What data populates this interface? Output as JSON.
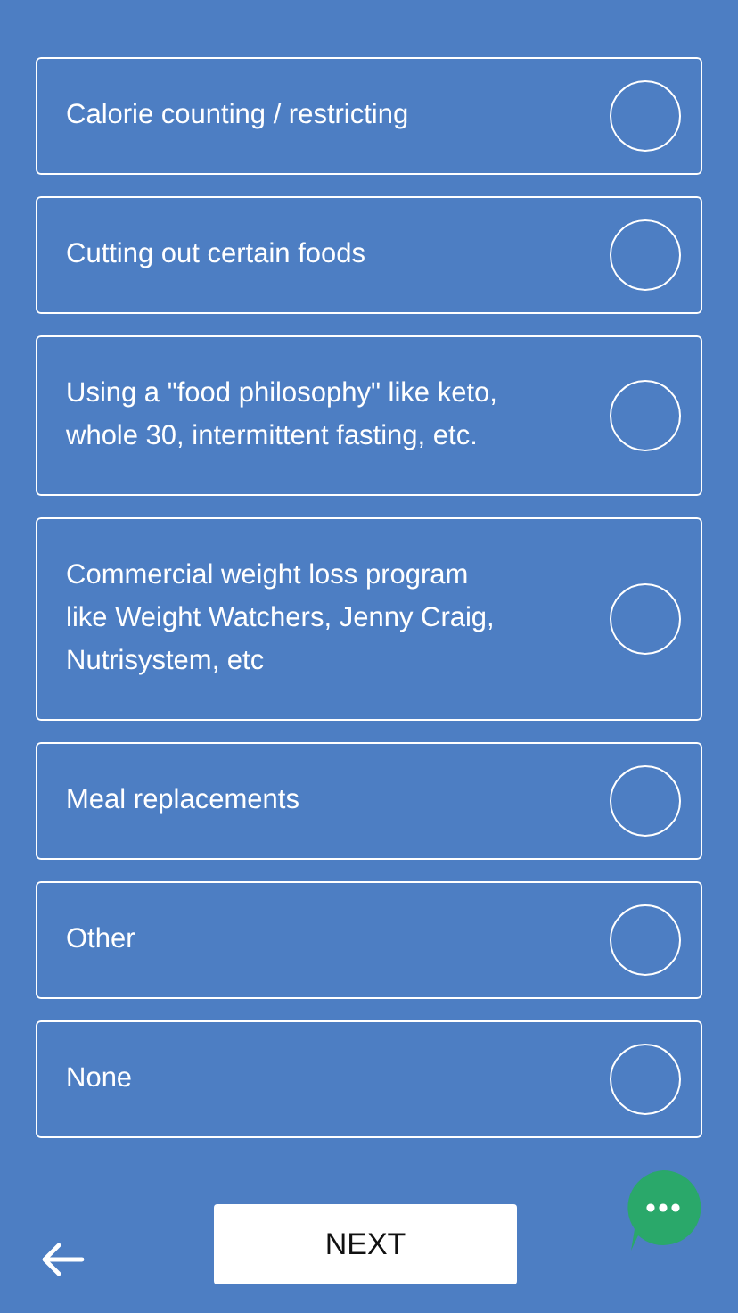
{
  "options": [
    {
      "label_lines": [
        "Calorie counting / restricting"
      ],
      "selected": false
    },
    {
      "label_lines": [
        "Cutting out certain foods"
      ],
      "selected": false
    },
    {
      "label_lines": [
        "Using a \"food philosophy\" like keto,",
        "whole 30, intermittent fasting, etc."
      ],
      "selected": false
    },
    {
      "label_lines": [
        "Commercial weight loss program",
        "like Weight Watchers, Jenny Craig,",
        "Nutrisystem, etc"
      ],
      "selected": false
    },
    {
      "label_lines": [
        "Meal replacements"
      ],
      "selected": false
    },
    {
      "label_lines": [
        "Other"
      ],
      "selected": false
    },
    {
      "label_lines": [
        "None"
      ],
      "selected": false
    }
  ],
  "next_button": "NEXT"
}
